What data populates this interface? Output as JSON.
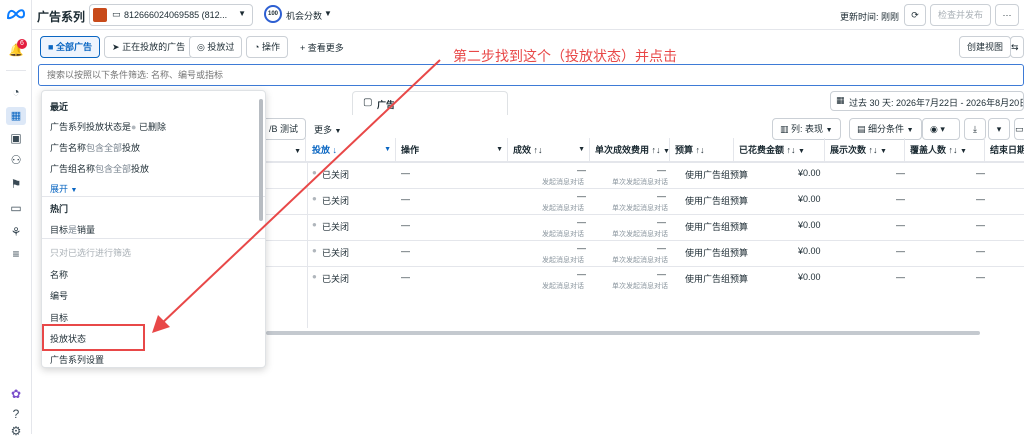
{
  "topbar": {
    "title": "广告系列",
    "account": "812666024069585 (812...",
    "score_badge": "100",
    "score_label": "机会分数",
    "update_label": "更新时间: 刚刚",
    "review_publish": "检查并发布"
  },
  "filter_tabs": {
    "all_ads": "全部广告",
    "active_ads": "正在投放的广告",
    "delivered": "投放过",
    "actions": "操作",
    "more": "查看更多",
    "create_view": "创建视图"
  },
  "search": {
    "placeholder": "搜索以按照以下条件筛选: 名称、编号或指标"
  },
  "annotation": "第二步找到这个（投放状态）并点击",
  "tabs": {
    "ads_tab": "广告"
  },
  "date_range": "过去 30 天: 2026年7月22日 - 2026年8月20日",
  "toolbar": {
    "ab_test": "/B 测试",
    "more": "更多",
    "columns": "列: 表现",
    "breakdown": "细分条件"
  },
  "dropdown": {
    "recent_header": "最近",
    "recent1_a": "广告系列投放状态是",
    "recent1_b": "已删除",
    "recent2_a": "广告名称",
    "recent2_b": "包含全部",
    "recent2_c": "投放",
    "recent3_a": "广告组名称",
    "recent3_b": "包含全部",
    "recent3_c": "投放",
    "expand": "展开",
    "popular_header": "热门",
    "popular1_a": "目标",
    "popular1_b": "是",
    "popular1_c": "销量",
    "filter_hint": "只对已选行进行筛选",
    "items": [
      "名称",
      "编号",
      "目标",
      "投放状态",
      "广告系列设置"
    ]
  },
  "columns": [
    "投放",
    "操作",
    "成效",
    "单次成效费用",
    "预算",
    "已花费金额",
    "展示次数",
    "覆盖人数",
    "结束日期"
  ],
  "rows": [
    {
      "delivery": "已关闭",
      "action": "—",
      "result": "—",
      "result_sub": "发起消息对话",
      "cpr": "—",
      "cpr_sub": "单次发起消息对话",
      "budget": "使用广告组预算",
      "spent": "¥0.00",
      "impr": "—",
      "reach": "—"
    },
    {
      "delivery": "已关闭",
      "action": "—",
      "result": "—",
      "result_sub": "发起消息对话",
      "cpr": "—",
      "cpr_sub": "单次发起消息对话",
      "budget": "使用广告组预算",
      "spent": "¥0.00",
      "impr": "—",
      "reach": "—"
    },
    {
      "delivery": "已关闭",
      "action": "—",
      "result": "—",
      "result_sub": "发起消息对话",
      "cpr": "—",
      "cpr_sub": "单次发起消息对话",
      "budget": "使用广告组预算",
      "spent": "¥0.00",
      "impr": "—",
      "reach": "—"
    },
    {
      "delivery": "已关闭",
      "action": "—",
      "result": "—",
      "result_sub": "发起消息对话",
      "cpr": "—",
      "cpr_sub": "单次发起消息对话",
      "budget": "使用广告组预算",
      "spent": "¥0.00",
      "impr": "—",
      "reach": "—"
    },
    {
      "delivery": "已关闭",
      "action": "—",
      "result": "—",
      "result_sub": "发起消息对话",
      "cpr": "—",
      "cpr_sub": "单次发起消息对话",
      "budget": "使用广告组预算",
      "spent": "¥0.00",
      "impr": "—",
      "reach": "—"
    }
  ],
  "notif_count": "6",
  "colors": {
    "accent": "#0a66c2",
    "annotation_red": "#e84848"
  }
}
